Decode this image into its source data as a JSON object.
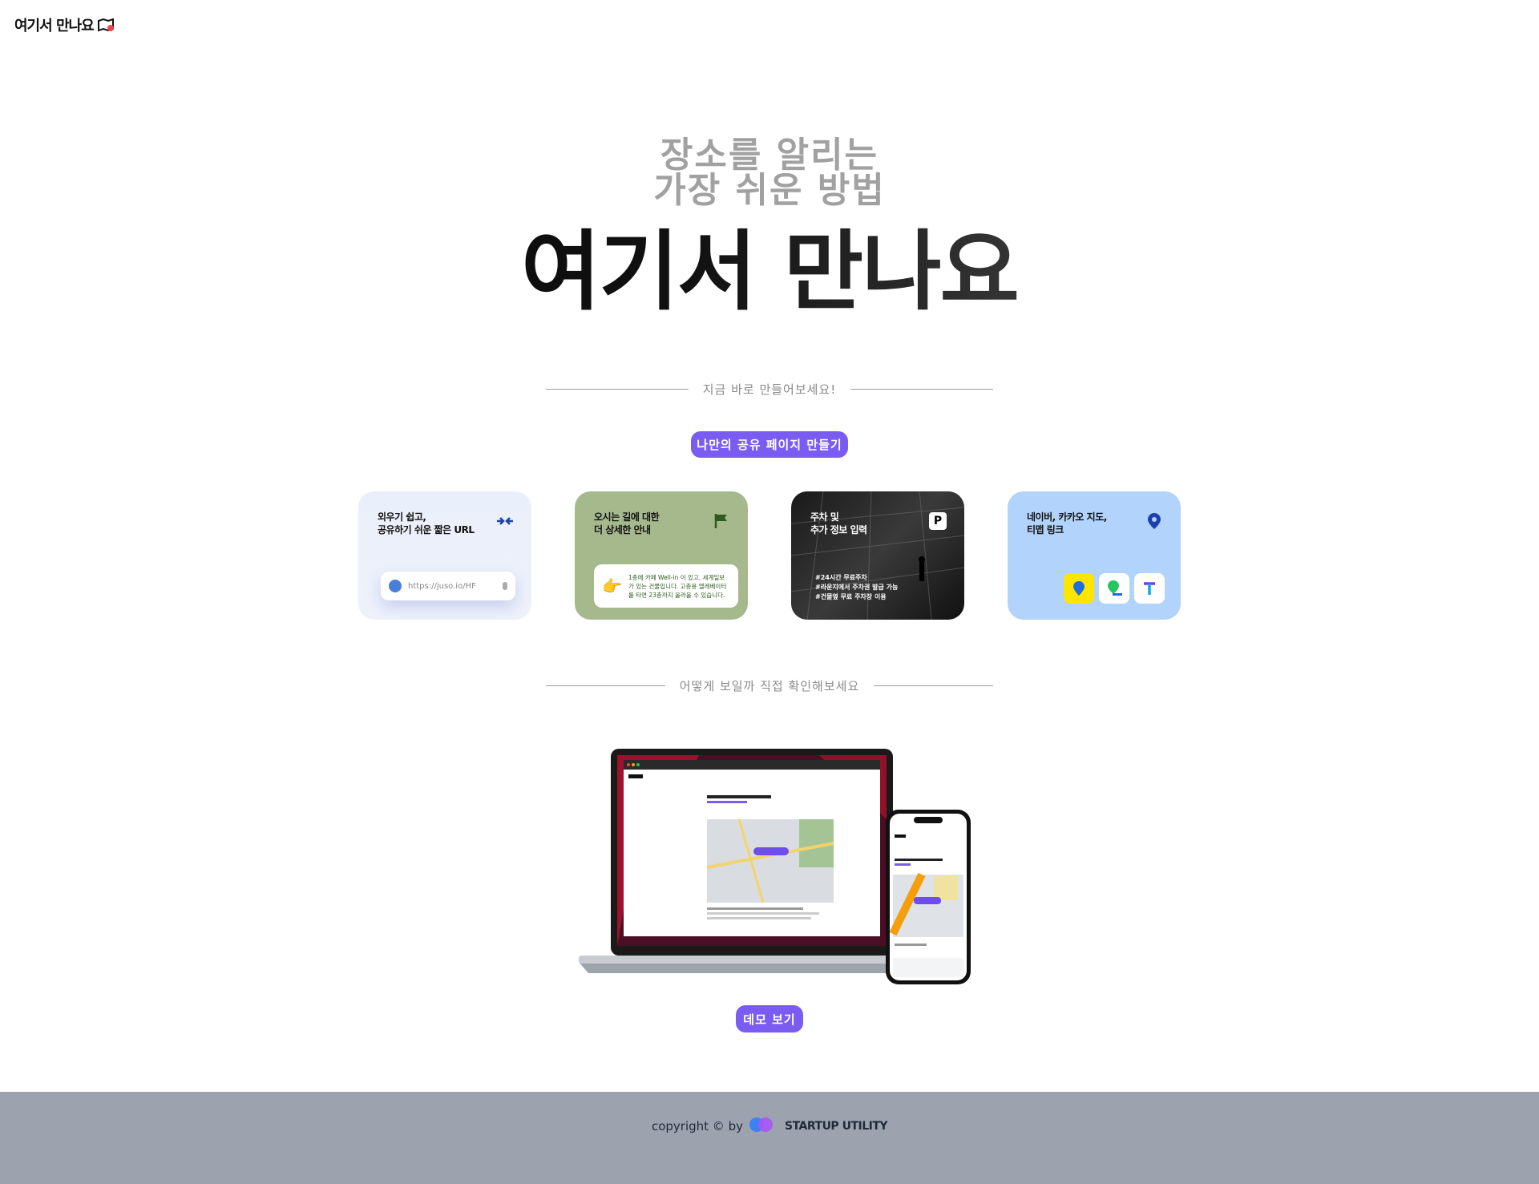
{
  "header": {
    "logo_text": "여기서 만나요"
  },
  "hero": {
    "subtitle_line1": "장소를 알리는",
    "subtitle_line2": "가장 쉬운 방법",
    "title": "여기서 만나요"
  },
  "section_create": {
    "divider_text": "지금 바로 만들어보세요!",
    "button_label": "나만의 공유 페이지 만들기"
  },
  "feature_cards": [
    {
      "title": "외우기 쉽고,\n공유하기 쉬운 짧은 URL",
      "url_preview": "https://juso.io/HF",
      "icon": "compress-arrows-icon"
    },
    {
      "title": "오시는 길에 대한\n더 상세한 안내",
      "bubble_text": "1층에 카페 Well-in 이 있고, 세계일보가 있는 건물입니다. 고층용 엘레베이터를 타면 23층까지 올라올 수 있습니다.",
      "icon": "flag-icon",
      "accent": "#2f5a1e"
    },
    {
      "title": "주차 및\n추가 정보 입력",
      "parking_text": "#24시간 무료주차\n#라운지에서 주차권 발급 가능\n#건물옆 무료 주차장 이용",
      "badge": "P"
    },
    {
      "title": "네이버, 카카오 지도,\n티맵 링크",
      "icon": "map-pin-icon"
    }
  ],
  "section_demo": {
    "divider_text": "어떻게 보일까 직접 확인해보세요",
    "button_label": "데모 보기"
  },
  "footer": {
    "copyright": "copyright © by",
    "brand": "STARTUP UTILITY"
  },
  "colors": {
    "accent": "#7a5cf2",
    "footer_bg": "#9ca3ae",
    "card_green": "#a6b98d",
    "card_blue": "#b2d3fb"
  }
}
